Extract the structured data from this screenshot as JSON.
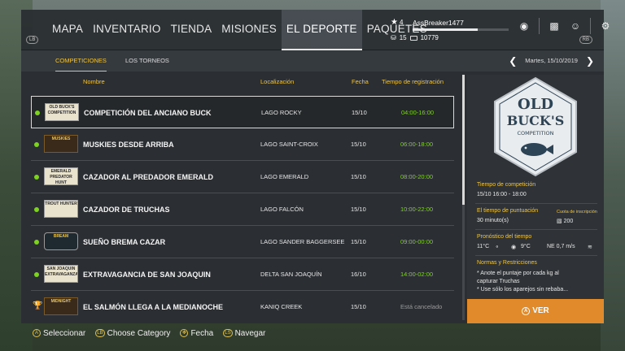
{
  "nav": {
    "lb": "LB",
    "rb": "RB",
    "tabs": [
      {
        "label": "MAPA"
      },
      {
        "label": "INVENTARIO"
      },
      {
        "label": "TIENDA"
      },
      {
        "label": "MISIONES"
      },
      {
        "label": "EL DEPORTE"
      },
      {
        "label": "PAQUETES"
      }
    ],
    "active_tab": "EL DEPORTE"
  },
  "profile": {
    "level": "4",
    "username": "AssBreaker1477",
    "xp_fraction": 0.68,
    "tokens": "15",
    "money": "10779"
  },
  "subnav": {
    "tabs": [
      {
        "label": "COMPETICIONES"
      },
      {
        "label": "LOS TORNEOS"
      }
    ],
    "date": "Martes, 15/10/2019"
  },
  "table": {
    "headers": {
      "name": "Nombre",
      "location": "Localización",
      "date": "Fecha",
      "time": "Tiempo de registración"
    },
    "rows": [
      {
        "logo": "OLD BUCK'S COMPETITION",
        "name": "COMPETICIÓN DEL ANCIANO BUCK",
        "location": "LAGO ROCKY",
        "date": "15/10",
        "time": "04:00-16:00",
        "status": "open"
      },
      {
        "logo": "MUSKIES",
        "name": "MUSKIES DESDE ARRIBA",
        "location": "LAGO SAINT-CROIX",
        "date": "15/10",
        "time": "06:00-18:00",
        "status": "open"
      },
      {
        "logo": "EMERALD PREDATOR HUNT",
        "name": "CAZADOR AL PREDADOR EMERALD",
        "location": "LAGO EMERALD",
        "date": "15/10",
        "time": "08:00-20:00",
        "status": "open"
      },
      {
        "logo": "TROUT HUNTER",
        "name": "CAZADOR DE TRUCHAS",
        "location": "LAGO FALCÓN",
        "date": "15/10",
        "time": "10:00-22:00",
        "status": "open"
      },
      {
        "logo": "BREAM",
        "name": "SUEÑO BREMA CAZAR",
        "location": "LAGO SANDER BAGGERSEE",
        "date": "15/10",
        "time": "09:00-00:00",
        "status": "open"
      },
      {
        "logo": "SAN JOAQUIN EXTRAVAGANZA",
        "name": "EXTRAVAGANCIA DE SAN JOAQUIN",
        "location": "DELTA SAN JOAQUÍN",
        "date": "16/10",
        "time": "14:00-02:00",
        "status": "open"
      },
      {
        "logo": "MIDNIGHT",
        "name": "EL SALMÓN LLEGA A LA MEDIANOCHE",
        "location": "KANIQ CREEK",
        "date": "15/10",
        "time": "Está cancelado",
        "status": "cancelled"
      }
    ]
  },
  "detail": {
    "badge_line1": "OLD",
    "badge_line2": "BUCK'S",
    "badge_line3": "COMPETITION",
    "comp_time_label": "Tiempo de competición",
    "comp_time_value": "15/10 16:00 - 18:00",
    "score_time_label": "El tiempo de puntuación",
    "score_time_value": "30 minuto(s)",
    "fee_label": "Cuota de inscripción",
    "fee_value": "200",
    "weather_label": "Pronóstico del tiempo",
    "weather_air": "11°C",
    "weather_water": "9°C",
    "weather_wind": "NE 0,7 m/s",
    "rules_label": "Normas y Restricciones",
    "rule_1": "* Anote el puntaje por cada kg al",
    "rule_2": "capturar Truchas",
    "rule_3": "* Use sólo los aparejos sin rebaba...",
    "button": "VER",
    "button_key": "A"
  },
  "hints": [
    {
      "key": "A",
      "label": "Seleccionar"
    },
    {
      "key": "LB",
      "label": "Choose Category"
    },
    {
      "key": "✥",
      "label": "Fecha"
    },
    {
      "key": "LS",
      "label": "Navegar"
    }
  ],
  "colors": {
    "accent": "#f0c542",
    "open": "#7ed321",
    "button": "#e08a2c"
  }
}
